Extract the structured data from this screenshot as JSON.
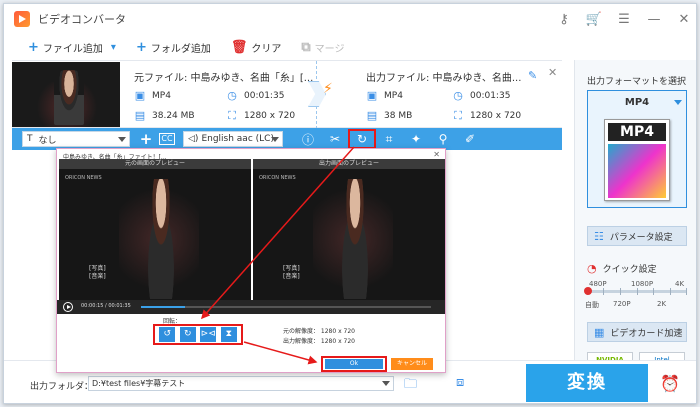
{
  "app": {
    "title": "ビデオコンバータ"
  },
  "toolbar": {
    "add_file": "ファイル追加",
    "add_folder": "フォルダ追加",
    "clear": "クリア",
    "merge": "マージ"
  },
  "file": {
    "source_name": "元ファイル: 中島みゆき、名曲「糸」[...",
    "source_format": "MP4",
    "source_duration": "00:01:35",
    "source_size": "38.24 MB",
    "source_resolution": "1280 x 720",
    "output_name": "出力ファイル: 中島みゆき、名曲...",
    "output_format": "MP4",
    "output_duration": "00:01:35",
    "output_size": "38 MB",
    "output_resolution": "1280 x 720"
  },
  "edit_bar": {
    "subtitle": "なし",
    "audio": "English aac (LC)"
  },
  "dialog": {
    "title": "中島みゆき、名曲「糸」ファイト！[...",
    "source_preview": "元の画面のプレビュー",
    "output_preview": "出力画面のプレビュー",
    "brand": "ORICON NEWS",
    "subtitle_text": "[写真]",
    "subtitle_text2": "[音楽]",
    "time": "00:00:15 / 00:01:35",
    "progress": 0.15,
    "rotate_label": "回転：",
    "source_res": "元の解像度：  1280 x 720",
    "output_res": "出力解像度：  1280 x 720",
    "ok": "Ok",
    "cancel": "キャンセル"
  },
  "right_panel": {
    "title": "出力フォーマットを選択",
    "format": "MP4",
    "format_icon_text": "MP4",
    "param_button": "パラメータ設定",
    "quick_setting": "クイック設定",
    "res_labels_top": [
      "480P",
      "1080P",
      "4K"
    ],
    "res_labels_bottom": [
      "自動",
      "720P",
      "2K"
    ],
    "gpu_button": "ビデオカード加速",
    "gpu_vendors": [
      "NVIDIA",
      "Intel"
    ]
  },
  "bottom": {
    "folder_label": "出力フォルダ：",
    "folder_path": "D:¥test files¥字幕テスト",
    "convert": "変換"
  },
  "colors": {
    "accent": "#2aa3ea",
    "highlight": "#e61a1a",
    "cancel": "#ff8c1a"
  }
}
